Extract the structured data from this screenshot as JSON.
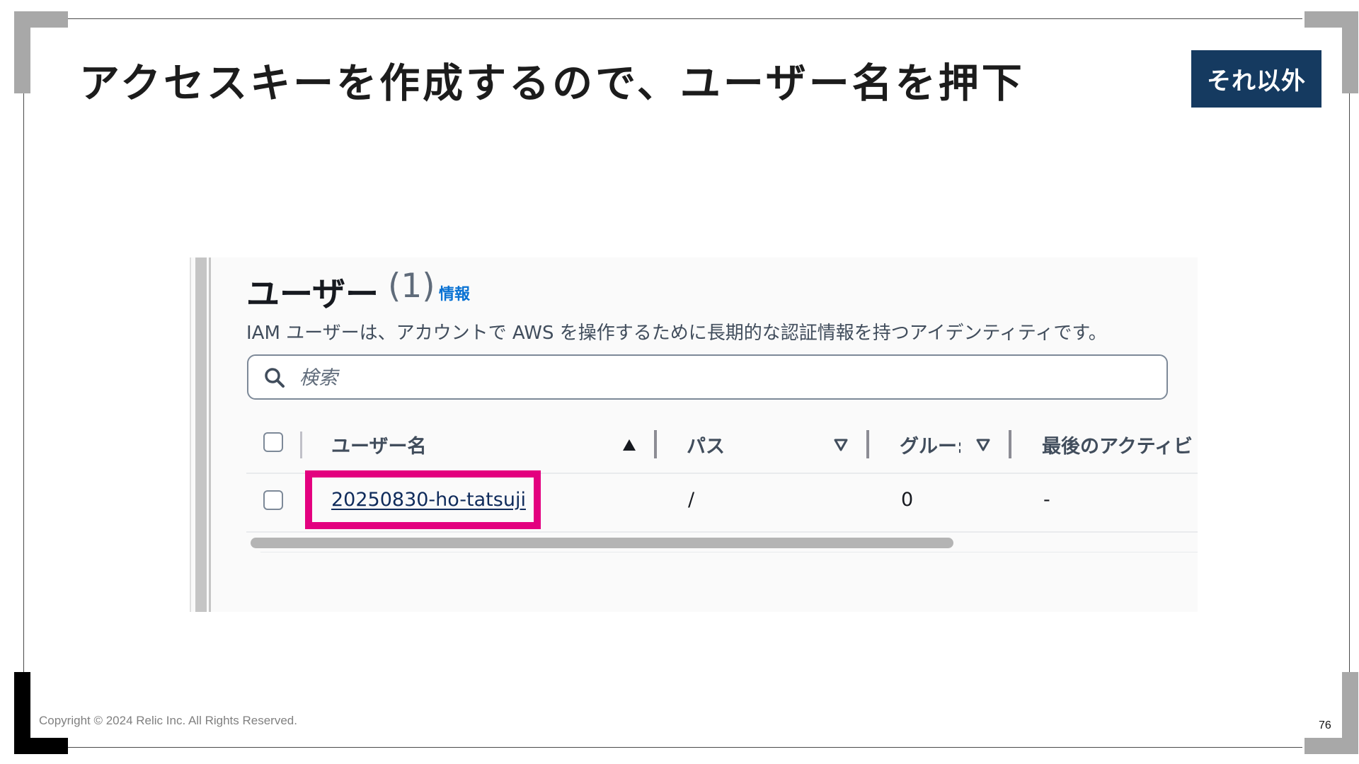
{
  "slide": {
    "title": "アクセスキーを作成するので、ユーザー名を押下",
    "tag_label": "それ以外",
    "copyright": "Copyright © 2024 Relic Inc. All Rights Reserved.",
    "page_number": "76"
  },
  "iam_users": {
    "heading": "ユーザー",
    "count": "(1)",
    "info_link": "情報",
    "description": "IAM ユーザーは、アカウントで AWS を操作するために長期的な認証情報を持つアイデンティティです。",
    "search_placeholder": "検索",
    "columns": [
      "ユーザー名",
      "パス",
      "グルー:",
      "最後のアクティビ"
    ],
    "rows": [
      {
        "username": "20250830-ho-tatsuji",
        "path": "/",
        "groups": "0",
        "last_activity": "-"
      }
    ]
  },
  "colors": {
    "tag_background": "#153a60",
    "highlight_border": "#e3007f",
    "link": "#0f2b5b",
    "info_link": "#0972d3"
  }
}
